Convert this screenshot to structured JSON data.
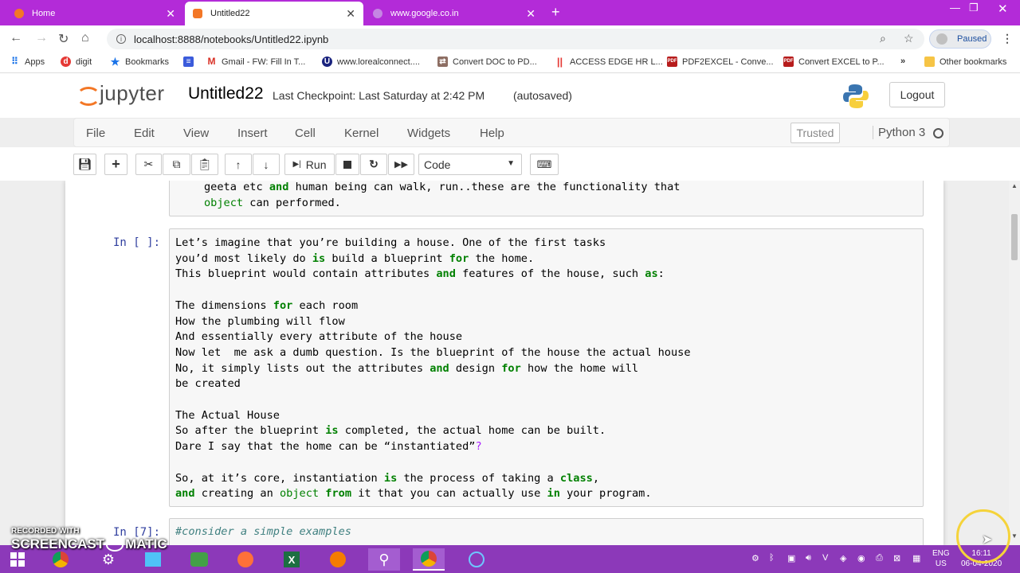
{
  "browser": {
    "tabs": [
      {
        "label": "Home",
        "active": false
      },
      {
        "label": "Untitled22",
        "active": true
      },
      {
        "label": "www.google.co.in",
        "active": false
      }
    ],
    "url": "localhost:8888/notebooks/Untitled22.ipynb",
    "profile_status": "Paused",
    "bookmarks": [
      {
        "label": "Apps",
        "icon": "apps-grid-icon"
      },
      {
        "label": "digit",
        "icon": "digit-icon"
      },
      {
        "label": "Bookmarks",
        "icon": "star-icon"
      },
      {
        "label": "",
        "icon": "doc-icon"
      },
      {
        "label": "Gmail - FW: Fill In T...",
        "icon": "gmail-icon"
      },
      {
        "label": "www.lorealconnect....",
        "icon": "loreal-icon"
      },
      {
        "label": "Convert DOC to PD...",
        "icon": "convert-icon"
      },
      {
        "label": "ACCESS EDGE HR L...",
        "icon": "access-icon"
      },
      {
        "label": "PDF2EXCEL - Conve...",
        "icon": "pdf-icon"
      },
      {
        "label": "Convert EXCEL to P...",
        "icon": "pdf-icon"
      },
      {
        "label": "Other bookmarks",
        "icon": "folder-icon"
      }
    ],
    "more_bookmarks": "»"
  },
  "jupyter": {
    "logo_text": "jupyter",
    "notebook_name": "Untitled22",
    "checkpoint": "Last Checkpoint: Last Saturday at 2:42 PM",
    "autosaved": "(autosaved)",
    "logout_label": "Logout",
    "menu": [
      "File",
      "Edit",
      "View",
      "Insert",
      "Cell",
      "Kernel",
      "Widgets",
      "Help"
    ],
    "trusted_label": "Trusted",
    "kernel_name": "Python 3",
    "run_label": "Run",
    "cell_type": "Code"
  },
  "cells": {
    "prev_tail": {
      "line1_pre": "geeta etc ",
      "line1_kw": "and",
      "line1_post": " human being can walk, run..these are the functionality that",
      "line2_tok": "object",
      "line2_post": " can performed."
    },
    "main": {
      "prompt": "In [ ]:",
      "l1": "Let’s imagine that you’re building a house. One of the first tasks",
      "l2a": "you’d most likely do ",
      "l2k": "is",
      "l2b": " build a blueprint ",
      "l2k2": "for",
      "l2c": " the home.",
      "l3a": "This blueprint would contain attributes ",
      "l3k": "and",
      "l3b": " features of the house, such ",
      "l3k2": "as",
      "l3c": ":",
      "l5a": "The dimensions ",
      "l5k": "for",
      "l5b": " each room",
      "l6": "How the plumbing will flow",
      "l7": "And essentially every attribute of the house",
      "l8": "Now let  me ask a dumb question. Is the blueprint of the house the actual house",
      "l9a": "No, it simply lists out the attributes ",
      "l9k": "and",
      "l9b": " design ",
      "l9k2": "for",
      "l9c": " how the home will",
      "l10": "be created",
      "l12": "The Actual House",
      "l13a": "So after the blueprint ",
      "l13k": "is",
      "l13b": " completed, the actual home can be built.",
      "l14a": "Dare I say that the home can be “instantiated”",
      "l14q": "?",
      "l16a": "So, at it’s core, instantiation ",
      "l16k": "is",
      "l16b": " the process of taking a ",
      "l16k2": "class",
      "l16c": ",",
      "l17k": "and",
      "l17a": " creating an ",
      "l17t": "object",
      "l17b": " ",
      "l17k2": "from",
      "l17c": " it that you can actually use ",
      "l17k3": "in",
      "l17d": " your program."
    },
    "next": {
      "prompt": "In [7]:",
      "comment": "#consider a simple examples"
    }
  },
  "taskbar": {
    "watermark_top": "RECORDED WITH",
    "watermark_main": "SCREENCAST",
    "watermark_end": "MATIC",
    "lang1": "ENG",
    "lang2": "US",
    "time": "16:11",
    "date": "06-04-2020"
  }
}
